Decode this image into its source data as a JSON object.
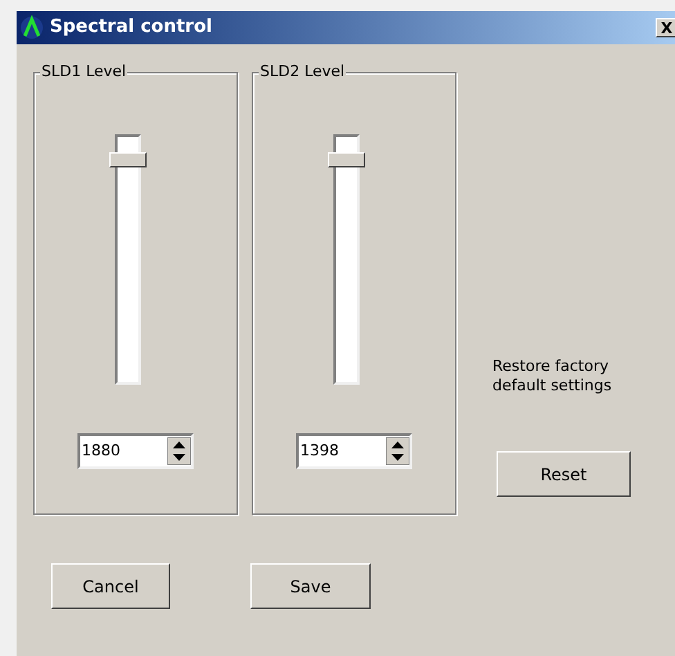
{
  "window": {
    "title": "Spectral control",
    "close": "X"
  },
  "groups": [
    {
      "label": "SLD1 Level",
      "level": 0.92,
      "value": "1880"
    },
    {
      "label": "SLD2 Level",
      "level": 0.92,
      "value": "1398"
    }
  ],
  "restore_note": "Restore factory default settings",
  "buttons": {
    "reset": "Reset",
    "cancel": "Cancel",
    "save": "Save"
  }
}
